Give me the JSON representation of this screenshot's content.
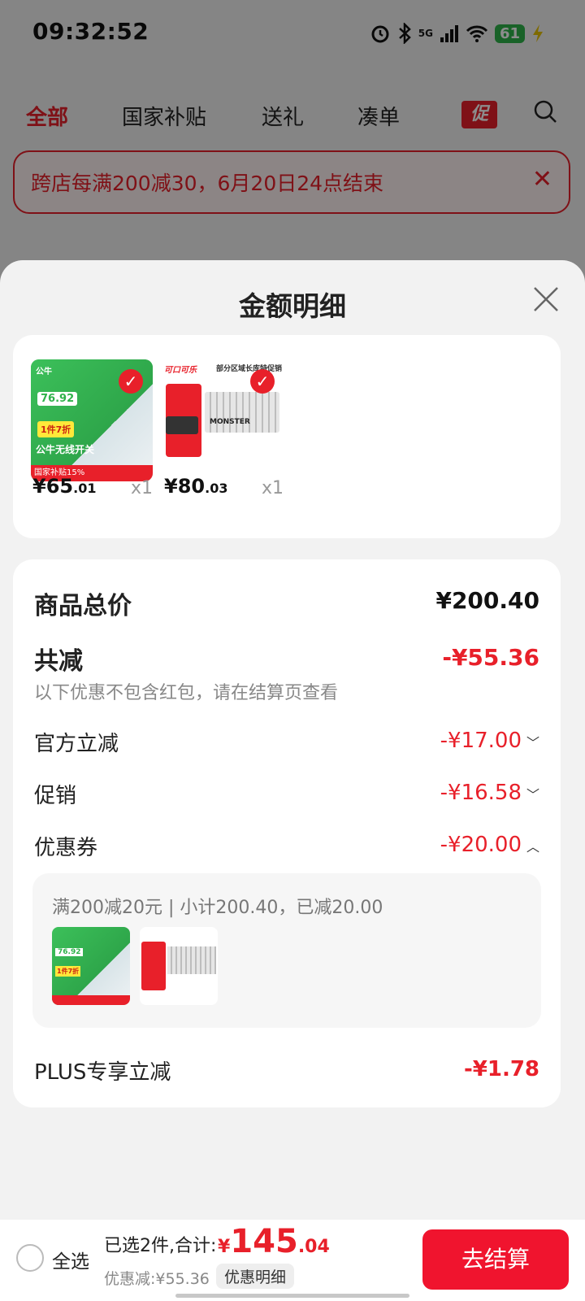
{
  "status_bar": {
    "time": "09:32:52",
    "battery": "61",
    "network": "5G"
  },
  "background": {
    "tabs": [
      "全部",
      "国家补贴",
      "送礼",
      "凑单"
    ],
    "promo_tab": "促",
    "banner": "跨店每满200减30，6月20日24点结束"
  },
  "sheet": {
    "title": "金额明细",
    "products": [
      {
        "price_int": "¥65",
        "price_dec": ".01",
        "qty": "x1",
        "img_text": {
          "brand": "公牛",
          "price": "76.92",
          "discount": "1件7折",
          "name": "公牛无线开关",
          "tag": "国家补贴15%"
        }
      },
      {
        "price_int": "¥80",
        "price_dec": ".03",
        "qty": "x1",
        "img_text": {
          "brand": "可口可乐",
          "header": "部分区域长库特促销",
          "product": "MONSTER"
        }
      }
    ],
    "total_label": "商品总价",
    "total_value": "¥200.40",
    "reduce_label": "共减",
    "reduce_value": "-¥55.36",
    "note": "以下优惠不包含红包，请在结算页查看",
    "items": [
      {
        "label": "官方立减",
        "value": "-¥17.00"
      },
      {
        "label": "促销",
        "value": "-¥16.58"
      },
      {
        "label": "优惠券",
        "value": "-¥20.00"
      }
    ],
    "coupon_detail": "满200减20元 | 小计200.40，已减20.00",
    "plus_label": "PLUS专享立减",
    "plus_value": "-¥1.78"
  },
  "bottom": {
    "select_all": "全选",
    "summary": "已选2件,合计:",
    "total_symbol": "¥",
    "total_int": "145",
    "total_dec": ".04",
    "discount": "优惠减:¥55.36",
    "detail_button": "优惠明细",
    "checkout": "去结算"
  },
  "colors": {
    "accent": "#e8202a",
    "checkout": "#f0142e"
  }
}
